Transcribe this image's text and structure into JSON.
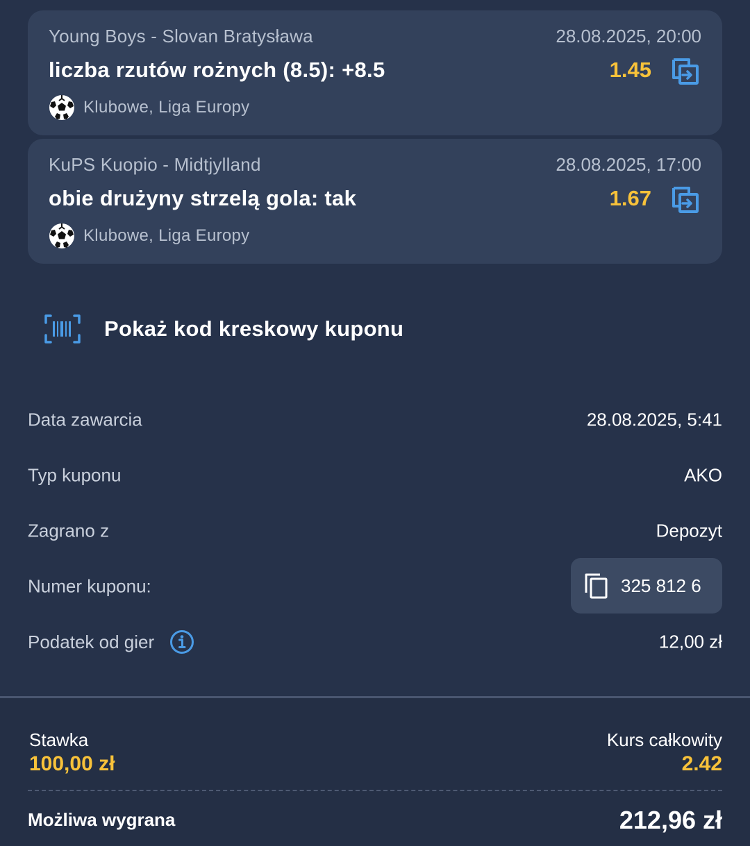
{
  "bets": [
    {
      "match": "Young Boys - Slovan Bratysława",
      "date": "28.08.2025, 20:00",
      "selection": "liczba rzutów rożnych (8.5): +8.5",
      "odds": "1.45",
      "league": "Klubowe, Liga Europy"
    },
    {
      "match": "KuPS Kuopio - Midtjylland",
      "date": "28.08.2025, 17:00",
      "selection": "obie drużyny strzelą gola: tak",
      "odds": "1.67",
      "league": "Klubowe, Liga Europy"
    }
  ],
  "barcode": {
    "label": "Pokaż kod kreskowy kuponu"
  },
  "details": {
    "date_label": "Data zawarcia",
    "date_value": "28.08.2025, 5:41",
    "type_label": "Typ kuponu",
    "type_value": "AKO",
    "source_label": "Zagrano z",
    "source_value": "Depozyt",
    "number_label": "Numer kuponu:",
    "number_value": "325 812 6",
    "tax_label": "Podatek od gier",
    "tax_value": "12,00 zł"
  },
  "summary": {
    "stake_label": "Stawka",
    "stake_value": "100,00 zł",
    "total_odds_label": "Kurs całkowity",
    "total_odds_value": "2.42",
    "win_label": "Możliwa wygrana",
    "win_value": "212,96 zł"
  },
  "icons": {
    "share": "share-icon",
    "ball": "soccer-ball-icon",
    "barcode": "barcode-scan-icon",
    "copy": "copy-icon",
    "info": "info-icon"
  },
  "colors": {
    "background": "#26324a",
    "card": "#33415b",
    "accent_yellow": "#f8c23a",
    "accent_blue": "#4a9be6"
  }
}
